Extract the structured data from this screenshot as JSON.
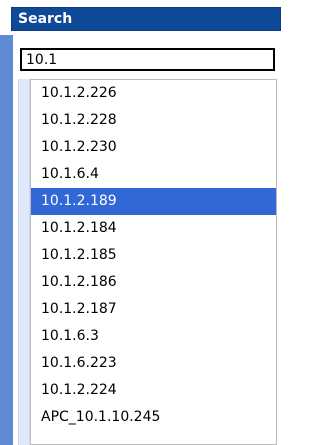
{
  "header": {
    "title": "Search"
  },
  "search": {
    "value": "10.1"
  },
  "dropdown": {
    "items": [
      {
        "label": "10.1.2.226",
        "selected": false
      },
      {
        "label": "10.1.2.228",
        "selected": false
      },
      {
        "label": "10.1.2.230",
        "selected": false
      },
      {
        "label": "10.1.6.4",
        "selected": false
      },
      {
        "label": "10.1.2.189",
        "selected": true
      },
      {
        "label": "10.1.2.184",
        "selected": false
      },
      {
        "label": "10.1.2.185",
        "selected": false
      },
      {
        "label": "10.1.2.186",
        "selected": false
      },
      {
        "label": "10.1.2.187",
        "selected": false
      },
      {
        "label": "10.1.6.3",
        "selected": false
      },
      {
        "label": "10.1.6.223",
        "selected": false
      },
      {
        "label": "10.1.2.224",
        "selected": false
      },
      {
        "label": "APC_10.1.10.245",
        "selected": false
      }
    ]
  },
  "colors": {
    "header_bg": "#0f4a98",
    "selected_bg": "#3268d6",
    "left_strip": "#5f8ad4"
  }
}
